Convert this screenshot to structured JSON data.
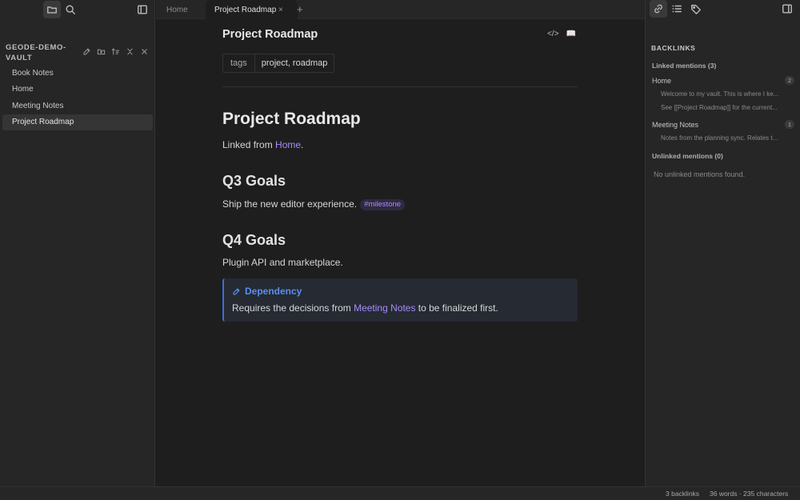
{
  "left_sidebar": {
    "vault_name": "GEODE-DEMO-VAULT",
    "files": [
      "Book Notes",
      "Home",
      "Meeting Notes",
      "Project Roadmap"
    ],
    "active_file": "Project Roadmap"
  },
  "tabs": {
    "items": [
      {
        "label": "Home"
      },
      {
        "label": "Project Roadmap"
      }
    ],
    "close_glyph": "×",
    "add_glyph": "+"
  },
  "editor": {
    "title": "Project Roadmap",
    "source_toggle": "</>",
    "reading_icon": "📖",
    "property_key": "tags",
    "property_value": "project, roadmap",
    "h1": "Project Roadmap",
    "linked_from_prefix": "Linked from ",
    "linked_from_link": "Home",
    "linked_from_suffix": ".",
    "q3_heading": "Q3 Goals",
    "q3_text": "Ship the new editor experience.",
    "q3_tag": "#milestone",
    "q4_heading": "Q4 Goals",
    "q4_text": "Plugin API and marketplace.",
    "callout_title": "Dependency",
    "callout_prefix": "Requires the decisions from ",
    "callout_link": "Meeting Notes",
    "callout_suffix": " to be finalized first."
  },
  "backlinks": {
    "heading": "BACKLINKS",
    "linked_label": "Linked mentions (3)",
    "groups": [
      {
        "file": "Home",
        "count": "2",
        "snippets": [
          "Welcome to my vault. This is where I ke...",
          "See [[Project Roadmap]] for the current..."
        ]
      },
      {
        "file": "Meeting Notes",
        "count": "1",
        "snippets": [
          "Notes from the planning sync. Relates t..."
        ]
      }
    ],
    "unlinked_label": "Unlinked mentions (0)",
    "unlinked_empty": "No unlinked mentions found."
  },
  "status": {
    "backlinks": "3 backlinks",
    "counts": "36 words · 235 characters"
  },
  "colors": {
    "accent_link": "#a88bfa",
    "callout_blue": "#5a8ef0",
    "background": "#1e1e1e",
    "sidebar": "#262626"
  },
  "icons": [
    "folder-icon",
    "search-icon",
    "sidebar-toggle-icon",
    "link-icon",
    "list-icon",
    "tag-icon",
    "right-sidebar-toggle-icon",
    "new-note-icon",
    "new-folder-icon",
    "sort-icon",
    "collapse-icon",
    "close-icon",
    "pencil-icon"
  ]
}
